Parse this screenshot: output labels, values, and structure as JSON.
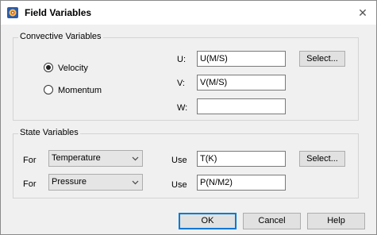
{
  "window": {
    "title": "Field Variables",
    "close_glyph": "✕"
  },
  "convective": {
    "group_label": "Convective Variables",
    "options": [
      {
        "label": "Velocity",
        "selected": true
      },
      {
        "label": "Momentum",
        "selected": false
      }
    ],
    "fields": [
      {
        "label": "U:",
        "value": "U(M/S)"
      },
      {
        "label": "V:",
        "value": "V(M/S)"
      },
      {
        "label": "W:",
        "value": ""
      }
    ],
    "select_label": "Select..."
  },
  "state": {
    "group_label": "State Variables",
    "rows": [
      {
        "for_label": "For",
        "variable": "Temperature",
        "use_label": "Use",
        "value": "T(K)"
      },
      {
        "for_label": "For",
        "variable": "Pressure",
        "use_label": "Use",
        "value": "P(N/M2)"
      }
    ],
    "select_label": "Select..."
  },
  "buttons": {
    "ok": "OK",
    "cancel": "Cancel",
    "help": "Help"
  },
  "colors": {
    "default_button_border": "#0078d7",
    "dialog_background": "#f0f0f0"
  }
}
